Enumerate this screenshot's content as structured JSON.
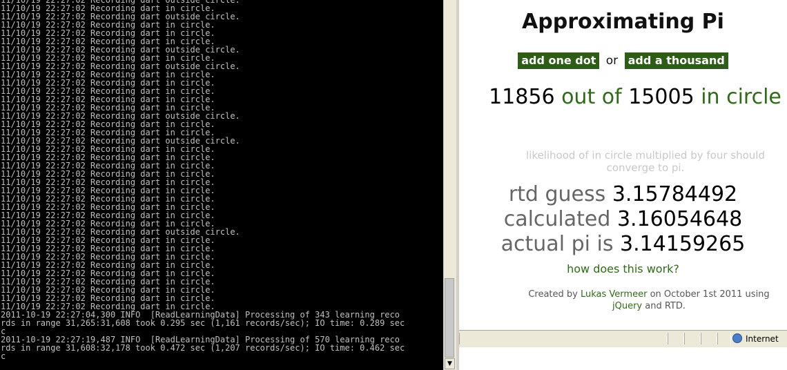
{
  "console": {
    "lines": [
      "11/10/19 22:27:02 Recording dart outside circle.",
      "11/10/19 22:27:02 Recording dart in circle.",
      "11/10/19 22:27:02 Recording dart outside circle.",
      "11/10/19 22:27:02 Recording dart in circle.",
      "11/10/19 22:27:02 Recording dart in circle.",
      "11/10/19 22:27:02 Recording dart in circle.",
      "11/10/19 22:27:02 Recording dart outside circle.",
      "11/10/19 22:27:02 Recording dart in circle.",
      "11/10/19 22:27:02 Recording dart outside circle.",
      "11/10/19 22:27:02 Recording dart in circle.",
      "11/10/19 22:27:02 Recording dart in circle.",
      "11/10/19 22:27:02 Recording dart in circle.",
      "11/10/19 22:27:02 Recording dart in circle.",
      "11/10/19 22:27:02 Recording dart in circle.",
      "11/10/19 22:27:02 Recording dart outside circle.",
      "11/10/19 22:27:02 Recording dart in circle.",
      "11/10/19 22:27:02 Recording dart in circle.",
      "11/10/19 22:27:02 Recording dart outside circle.",
      "11/10/19 22:27:02 Recording dart in circle.",
      "11/10/19 22:27:02 Recording dart in circle.",
      "11/10/19 22:27:02 Recording dart in circle.",
      "11/10/19 22:27:02 Recording dart in circle.",
      "11/10/19 22:27:02 Recording dart in circle.",
      "11/10/19 22:27:02 Recording dart in circle.",
      "11/10/19 22:27:02 Recording dart in circle.",
      "11/10/19 22:27:02 Recording dart in circle.",
      "11/10/19 22:27:02 Recording dart in circle.",
      "11/10/19 22:27:02 Recording dart in circle.",
      "11/10/19 22:27:02 Recording dart outside circle.",
      "11/10/19 22:27:02 Recording dart in circle.",
      "11/10/19 22:27:02 Recording dart in circle.",
      "11/10/19 22:27:02 Recording dart in circle.",
      "11/10/19 22:27:02 Recording dart in circle.",
      "11/10/19 22:27:02 Recording dart in circle.",
      "11/10/19 22:27:02 Recording dart in circle.",
      "11/10/19 22:27:02 Recording dart in circle.",
      "11/10/19 22:27:02 Recording dart in circle.",
      "11/10/19 22:27:02 Recording dart in circle.",
      "2011-10-19 22:27:04,300 INFO  [ReadLearningData] Processing of 343 learning reco",
      "rds in range 31,265:31,608 took 0.295 sec (1,161 records/sec); IO time: 0.289 sec",
      "c",
      "2011-10-19 22:27:19,487 INFO  [ReadLearningData] Processing of 570 learning reco",
      "rds in range 31,608:32,178 took 0.472 sec (1,207 records/sec); IO time: 0.462 sec",
      "c"
    ]
  },
  "page": {
    "title": "Approximating Pi",
    "add_one_label": "add one dot",
    "or_label": "or",
    "add_thousand_label": "add a thousand",
    "in_count": "11856",
    "out_of_label": "out of",
    "total_count": "15005",
    "in_circle_label": "in circle",
    "explanation": "likelihood of in circle multiplied by four should converge to pi.",
    "rtd_label": "rtd guess",
    "rtd_value": "3.15784492",
    "calc_label": "calculated",
    "calc_value": "3.16054648",
    "actual_label": "actual pi is",
    "actual_value": "3.14159265",
    "how_link": "how does this work?",
    "credits_created_by": "Created by",
    "credits_author": "Lukas Vermeer",
    "credits_on": "on October 1st 2011 using",
    "credits_jquery": "jQuery",
    "credits_and": "and RTD."
  },
  "statusbar": {
    "zone_label": "Internet",
    "zone_icon": "globe-icon"
  },
  "colors": {
    "accent_green": "#2d6b14",
    "button_green": "#2d5d16",
    "console_bg": "#000000",
    "console_text": "#c0c0c0"
  }
}
